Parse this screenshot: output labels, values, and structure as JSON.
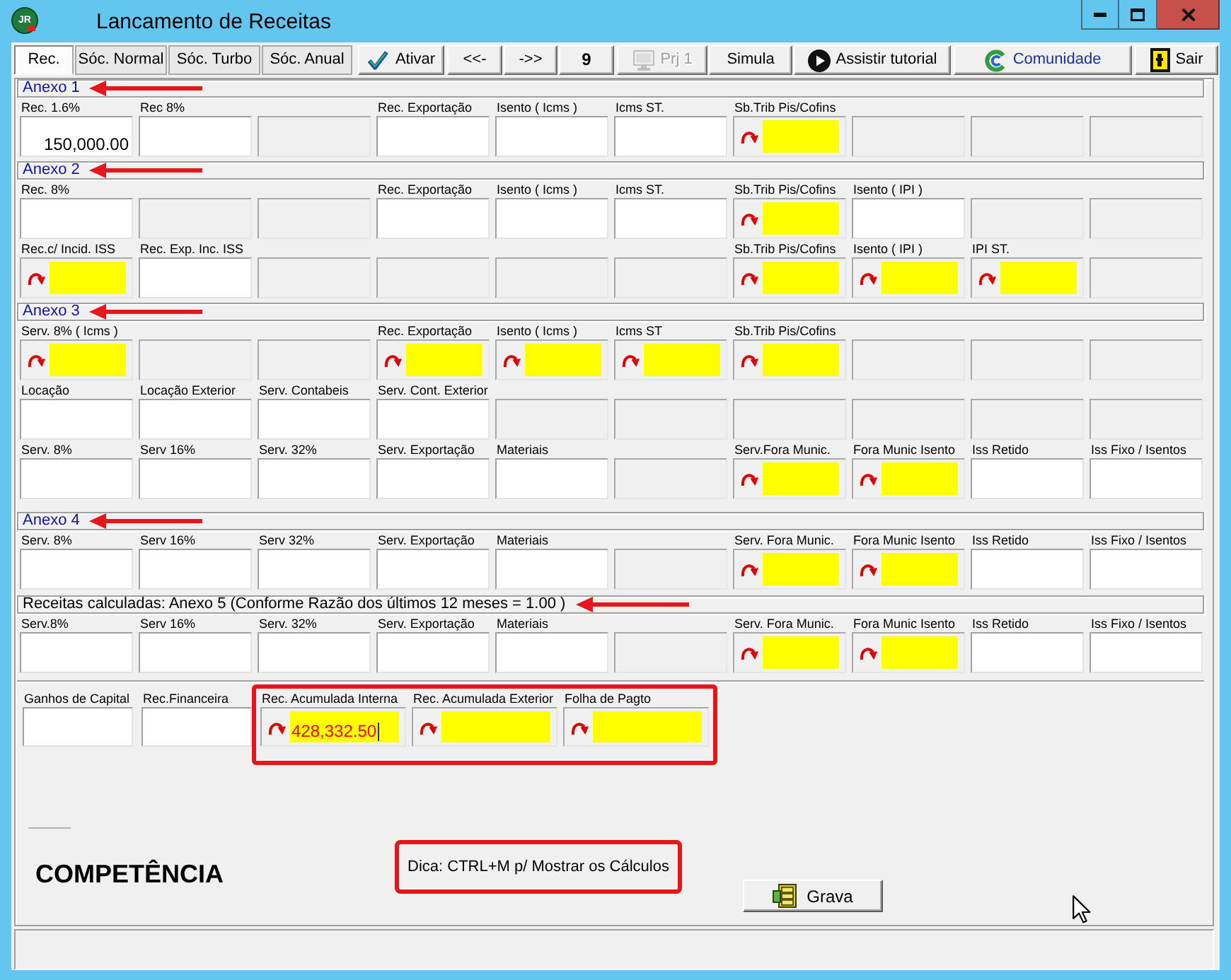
{
  "window": {
    "logo": "JR",
    "title": "Lancamento de Receitas"
  },
  "toolbar": {
    "tabs": [
      {
        "label": "Rec.",
        "selected": true
      },
      {
        "label": "Sóc. Normal",
        "selected": false
      },
      {
        "label": "Sóc. Turbo",
        "selected": false
      },
      {
        "label": "Sóc. Anual",
        "selected": false
      }
    ],
    "buttons": [
      {
        "label": "Ativar",
        "kind": "icon",
        "disabled": false
      },
      {
        "label": "<<-",
        "kind": "text",
        "disabled": false
      },
      {
        "label": "->>",
        "kind": "text",
        "disabled": false
      },
      {
        "label": "9",
        "kind": "count",
        "disabled": false
      },
      {
        "label": "Prj 1",
        "kind": "icon",
        "disabled": true
      },
      {
        "label": "Simula",
        "kind": "text",
        "disabled": false
      },
      {
        "label": "Assistir tutorial",
        "kind": "icon",
        "disabled": false
      },
      {
        "label": "Comunidade",
        "kind": "link",
        "disabled": false
      },
      {
        "label": "Sair",
        "kind": "icon",
        "disabled": false
      }
    ]
  },
  "sections": [
    {
      "title": "Anexo 1",
      "kind": "annex",
      "arrow_mark": true,
      "rows": [
        {
          "cells": [
            {
              "kind": "input",
              "label": "Rec. 1.6%",
              "value": "150,000.00"
            },
            {
              "kind": "input",
              "label": "Rec 8%"
            },
            {
              "kind": "blank"
            },
            {
              "kind": "input",
              "label": "Rec. Exportação"
            },
            {
              "kind": "input",
              "label": "Isento ( Icms )"
            },
            {
              "kind": "input",
              "label": "Icms ST."
            },
            {
              "kind": "calc",
              "label": "Sb.Trib Pis/Cofins"
            },
            {
              "kind": "blank"
            },
            {
              "kind": "blank"
            },
            {
              "kind": "blank"
            }
          ]
        }
      ]
    },
    {
      "title": "Anexo 2",
      "kind": "annex",
      "arrow_mark": true,
      "rows": [
        {
          "cells": [
            {
              "kind": "input",
              "label": "Rec. 8%"
            },
            {
              "kind": "blank"
            },
            {
              "kind": "blank"
            },
            {
              "kind": "input",
              "label": "Rec. Exportação"
            },
            {
              "kind": "input",
              "label": "Isento ( Icms )"
            },
            {
              "kind": "input",
              "label": "Icms ST."
            },
            {
              "kind": "calc",
              "label": "Sb.Trib Pis/Cofins"
            },
            {
              "kind": "input",
              "label": "Isento ( IPI )"
            },
            {
              "kind": "blank"
            },
            {
              "kind": "blank"
            }
          ]
        },
        {
          "cells": [
            {
              "kind": "calc",
              "label": "Rec.c/ Incid. ISS"
            },
            {
              "kind": "input",
              "label": "Rec. Exp. Inc. ISS"
            },
            {
              "kind": "blank"
            },
            {
              "kind": "blank"
            },
            {
              "kind": "blank"
            },
            {
              "kind": "blank"
            },
            {
              "kind": "calc",
              "label": "Sb.Trib Pis/Cofins"
            },
            {
              "kind": "calc",
              "label": "Isento ( IPI )"
            },
            {
              "kind": "calc",
              "label": "IPI ST."
            },
            {
              "kind": "blank"
            }
          ]
        }
      ]
    },
    {
      "title": "Anexo 3",
      "kind": "annex",
      "arrow_mark": true,
      "rows": [
        {
          "cells": [
            {
              "kind": "calc",
              "label": "Serv. 8% ( Icms )"
            },
            {
              "kind": "blank"
            },
            {
              "kind": "blank"
            },
            {
              "kind": "calc",
              "label": "Rec. Exportação"
            },
            {
              "kind": "calc",
              "label": "Isento ( Icms )"
            },
            {
              "kind": "calc",
              "label": "Icms ST"
            },
            {
              "kind": "calc",
              "label": "Sb.Trib Pis/Cofins"
            },
            {
              "kind": "blank"
            },
            {
              "kind": "blank"
            },
            {
              "kind": "blank"
            }
          ]
        },
        {
          "cells": [
            {
              "kind": "input",
              "label": "Locação"
            },
            {
              "kind": "input",
              "label": "Locação Exterior"
            },
            {
              "kind": "input",
              "label": "Serv. Contabeis"
            },
            {
              "kind": "input",
              "label": "Serv. Cont. Exterior"
            },
            {
              "kind": "blank"
            },
            {
              "kind": "blank"
            },
            {
              "kind": "blank"
            },
            {
              "kind": "blank"
            },
            {
              "kind": "blank"
            },
            {
              "kind": "blank"
            }
          ]
        },
        {
          "cells": [
            {
              "kind": "input",
              "label": "Serv. 8%"
            },
            {
              "kind": "input",
              "label": "Serv 16%"
            },
            {
              "kind": "input",
              "label": "Serv. 32%"
            },
            {
              "kind": "input",
              "label": "Serv. Exportação"
            },
            {
              "kind": "input",
              "label": "Materiais"
            },
            {
              "kind": "blank"
            },
            {
              "kind": "calc",
              "label": "Serv.Fora Munic."
            },
            {
              "kind": "calc",
              "label": "Fora Munic Isento"
            },
            {
              "kind": "input",
              "label": "Iss Retido"
            },
            {
              "kind": "input",
              "label": "Iss Fixo / Isentos"
            }
          ]
        }
      ]
    },
    {
      "title": "Anexo 4",
      "kind": "annex",
      "arrow_mark": true,
      "rows": [
        {
          "cells": [
            {
              "kind": "input",
              "label": "Serv. 8%"
            },
            {
              "kind": "input",
              "label": "Serv 16%"
            },
            {
              "kind": "input",
              "label": "Serv 32%"
            },
            {
              "kind": "input",
              "label": "Serv. Exportação"
            },
            {
              "kind": "input",
              "label": "Materiais"
            },
            {
              "kind": "blank"
            },
            {
              "kind": "calc",
              "label": "Serv. Fora Munic."
            },
            {
              "kind": "calc",
              "label": "Fora Munic Isento"
            },
            {
              "kind": "input",
              "label": "Iss Retido"
            },
            {
              "kind": "input",
              "label": "Iss Fixo / Isentos"
            }
          ]
        }
      ]
    },
    {
      "title": "Receitas calculadas: Anexo 5 (Conforme Razão dos últimos 12 meses = 1.00 )",
      "kind": "summary",
      "arrow_mark": true,
      "rows": [
        {
          "cells": [
            {
              "kind": "input",
              "label": "Serv.8%"
            },
            {
              "kind": "input",
              "label": "Serv 16%"
            },
            {
              "kind": "input",
              "label": "Serv. 32%"
            },
            {
              "kind": "input",
              "label": "Serv. Exportação"
            },
            {
              "kind": "input",
              "label": "Materiais"
            },
            {
              "kind": "blank"
            },
            {
              "kind": "calc",
              "label": "Serv. Fora Munic."
            },
            {
              "kind": "calc",
              "label": "Fora Munic Isento"
            },
            {
              "kind": "input",
              "label": "Iss Retido"
            },
            {
              "kind": "input",
              "label": "Iss Fixo / Isentos"
            }
          ]
        }
      ]
    }
  ],
  "bottom": {
    "fields": [
      {
        "kind": "input",
        "label": "Ganhos de Capital",
        "highlighted": false,
        "focused": false
      },
      {
        "kind": "input",
        "label": "Rec.Financeira",
        "highlighted": false,
        "focused": false
      },
      {
        "kind": "calc",
        "label": "Rec. Acumulada Interna",
        "value": "428,332.50",
        "highlighted": true,
        "focused": true
      },
      {
        "kind": "calc",
        "label": "Rec. Acumulada Exterior",
        "highlighted": true,
        "focused": false
      },
      {
        "kind": "calc",
        "label": "Folha de Pagto",
        "highlighted": true,
        "focused": false
      }
    ],
    "heading": "COMPETÊNCIA",
    "tip": {
      "text": "Dica: CTRL+M p/ Mostrar os Cálculos",
      "highlighted": true
    },
    "save_button": "Grava"
  }
}
